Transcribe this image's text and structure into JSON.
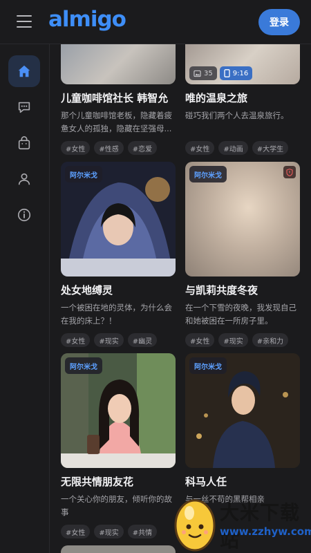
{
  "header": {
    "logo_text": "almigo",
    "login_label": "登录",
    "accent": "#3e8ef7"
  },
  "sidebar": {
    "items": [
      {
        "name": "home",
        "active": true
      },
      {
        "name": "chat",
        "active": false
      },
      {
        "name": "shop",
        "active": false
      },
      {
        "name": "profile",
        "active": false
      },
      {
        "name": "info",
        "active": false
      }
    ]
  },
  "cards": [
    {
      "title": "儿童咖啡馆社长 韩智允",
      "desc": "那个儿童咖啡馆老板，隐藏着疲惫女人的孤独，隐藏在坚强母...",
      "tags": [
        "#女性",
        "#性感",
        "#恋爱"
      ],
      "badge": ""
    },
    {
      "title": "唯的温泉之旅",
      "desc": "碰巧我们两个人去温泉旅行。",
      "tags": [
        "#女性",
        "#动画",
        "#大学生"
      ],
      "badge": "",
      "stat_images": "35",
      "stat_ratio": "9:16"
    },
    {
      "title": "处女地缚灵",
      "desc": "一个被困在地的灵体，为什么会在我的床上？！",
      "tags": [
        "#女性",
        "#现实",
        "#幽灵"
      ],
      "badge": "阿尔米戈"
    },
    {
      "title": "与凯莉共度冬夜",
      "desc": "在一个下雪的夜晚，我发现自己和她被困在一所房子里。",
      "tags": [
        "#女性",
        "#现实",
        "#亲和力"
      ],
      "badge": "阿尔米戈"
    },
    {
      "title": "无限共情朋友花",
      "desc": "一个关心你的朋友，倾听你的故事",
      "tags": [
        "#女性",
        "#现实",
        "#共情"
      ],
      "badge": "阿尔米戈"
    },
    {
      "title": "科马人任",
      "desc": "与一丝不苟的黑帮相亲",
      "tags": [],
      "badge": "阿尔米戈"
    }
  ],
  "watermark": {
    "title": "大米下载站",
    "url": "www.zzhyw.com"
  }
}
